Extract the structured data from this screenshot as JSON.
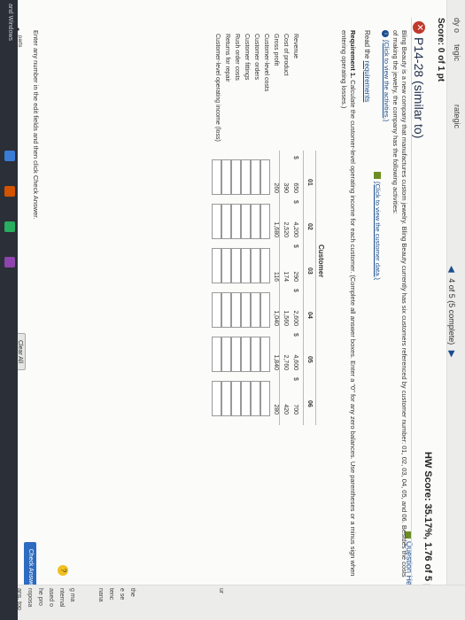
{
  "header": {
    "score": "Score: 0 of 1 pt",
    "hw_score": "HW Score: 35.17%, 1.76 of 5 pts",
    "nav_text": "4 of 5 (5 complete)",
    "prev_arrow": "◀",
    "next_arrow": "▶",
    "question_title": "P14-28 (similar to)",
    "question_help": "Question Help"
  },
  "problem": {
    "intro": "Bling Beauty is a new company that manufactures custom jewelry. Bling Beauty currently has six customers referenced by customer number: 01, 02, 03, 04, 05, and 06. Besides the costs of making the jewelry, the company has the following activities:",
    "link1": "(Click to view the activities.)",
    "link2": "(Click to view the customer data.)",
    "read_prefix": "Read the",
    "read_link": "requirements"
  },
  "requirement": {
    "label": "Requirement 1.",
    "text": "Calculate the customer-level operating income for each customer. (Complete all answer boxes. Enter a \"0\" for any zero balances. Use parentheses or a minus sign when entering operating losses.)"
  },
  "table": {
    "customer_header": "Customer",
    "columns": [
      "01",
      "02",
      "03",
      "04",
      "05",
      "06"
    ],
    "rows": [
      {
        "label": "Revenue",
        "values": [
          "650",
          "4,200",
          "290",
          "2,600",
          "4,600",
          "700"
        ],
        "dollar": true
      },
      {
        "label": "Cost of product",
        "values": [
          "390",
          "2,520",
          "174",
          "1,560",
          "2,760",
          "420"
        ],
        "dollar": false
      },
      {
        "label": "Gross profit",
        "values": [
          "260",
          "1,680",
          "116",
          "1,040",
          "1,840",
          "280"
        ],
        "dollar": false
      },
      {
        "label": "Customer-level costs",
        "values": [],
        "dollar": false
      },
      {
        "label": "Customer orders",
        "values": [],
        "dollar": false
      },
      {
        "label": "Customer fittings",
        "values": [],
        "dollar": false
      },
      {
        "label": "Rush order costs",
        "values": [],
        "dollar": false
      },
      {
        "label": "Returns for repair",
        "values": [],
        "dollar": false
      },
      {
        "label": "Customer-level operating income (loss)",
        "values": [],
        "dollar": false
      }
    ]
  },
  "footer": {
    "instructions": "Enter any number in the edit fields and then click Check Answer.",
    "parts_count": "4",
    "parts_label_1": "parts",
    "parts_label_2": "remaining",
    "clear_all": "Clear All",
    "check_answer": "Check Answer"
  },
  "edge_left": {
    "gutter_1": "dy o",
    "gutter_2": "tegic",
    "gutter_3": "rategic"
  },
  "edge_right": {
    "items": [
      "ur",
      "the",
      "e se",
      "tenc",
      "nana",
      "g ma",
      "nternal",
      "ased o",
      "he pro",
      "roposa",
      "ans, top"
    ],
    "help_badge": "?"
  },
  "taskbar": {
    "label": "and Windows"
  }
}
